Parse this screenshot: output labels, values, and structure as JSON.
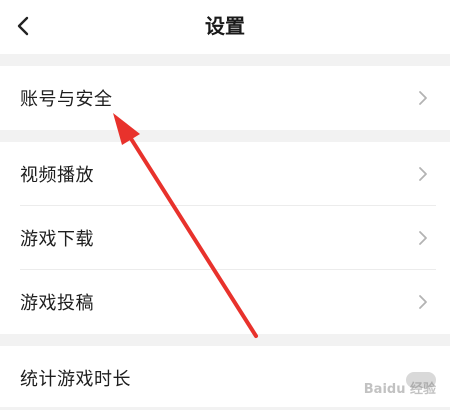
{
  "header": {
    "title": "设置"
  },
  "groups": [
    {
      "items": [
        {
          "label": "账号与安全",
          "type": "chevron"
        }
      ]
    },
    {
      "items": [
        {
          "label": "视频播放",
          "type": "chevron"
        },
        {
          "label": "游戏下载",
          "type": "chevron"
        },
        {
          "label": "游戏投稿",
          "type": "chevron"
        }
      ]
    },
    {
      "items": [
        {
          "label": "统计游戏时长",
          "type": "toggle"
        }
      ]
    }
  ],
  "watermark": "Baidu 经验",
  "colors": {
    "background": "#f2f2f2",
    "surface": "#ffffff",
    "annotation_arrow": "#e8322c",
    "chevron": "#b3b3b3"
  },
  "icons": {
    "back": "chevron-left-icon",
    "row_arrow": "chevron-right-icon"
  }
}
